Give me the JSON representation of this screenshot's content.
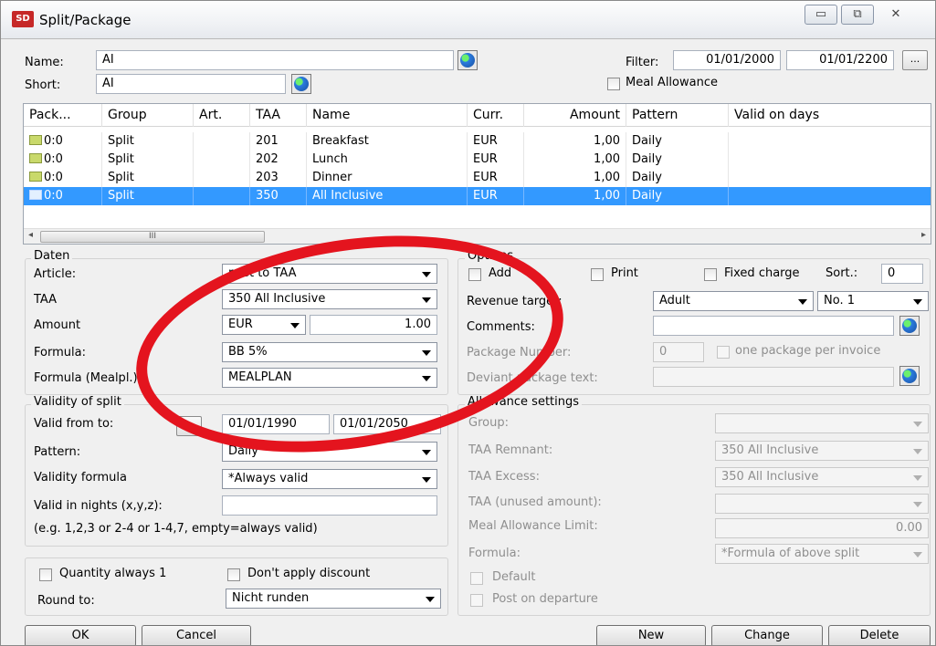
{
  "window": {
    "title": "Split/Package",
    "app_icon": "SD",
    "minimize_icon": "▭",
    "restore_icon": "⧉",
    "close_icon": "✕"
  },
  "header": {
    "name_label": "Name:",
    "name_value": "AI",
    "short_label": "Short:",
    "short_value": "AI",
    "filter_label": "Filter:",
    "filter_from": "01/01/2000",
    "filter_to": "01/01/2200",
    "filter_button": "...",
    "meal_allowance_label": "Meal Allowance"
  },
  "grid": {
    "columns": [
      "Pack...",
      "Group",
      "Art.",
      "TAA",
      "Name",
      "Curr.",
      "Amount",
      "Pattern",
      "Valid on days"
    ],
    "rows": [
      {
        "pack": "0:0",
        "group": "Split",
        "art": "",
        "taa": "201",
        "name": "Breakfast",
        "curr": "EUR",
        "amount": "1,00",
        "pattern": "Daily",
        "valid": ""
      },
      {
        "pack": "0:0",
        "group": "Split",
        "art": "",
        "taa": "202",
        "name": "Lunch",
        "curr": "EUR",
        "amount": "1,00",
        "pattern": "Daily",
        "valid": ""
      },
      {
        "pack": "0:0",
        "group": "Split",
        "art": "",
        "taa": "203",
        "name": "Dinner",
        "curr": "EUR",
        "amount": "1,00",
        "pattern": "Daily",
        "valid": ""
      },
      {
        "pack": "0:0",
        "group": "Split",
        "art": "",
        "taa": "350",
        "name": "All Inclusive",
        "curr": "EUR",
        "amount": "1,00",
        "pattern": "Daily",
        "valid": ""
      }
    ],
    "selected_row": 3,
    "scroll_left": "◂",
    "scroll_right": "▸",
    "scroll_thumb": "III"
  },
  "daten": {
    "title": "Daten",
    "article_label": "Article:",
    "article_value": "post to TAA",
    "taa_label": "TAA",
    "taa_value": "350 All Inclusive",
    "amount_label": "Amount",
    "currency_value": "EUR",
    "amount_value": "1.00",
    "formula_label": "Formula:",
    "formula_value": "BB 5%",
    "formula_mealpl_label": "Formula (Mealpl.):",
    "formula_mealpl_value": "MEALPLAN"
  },
  "validity": {
    "title": "Validity of split",
    "valid_from_label": "Valid from to:",
    "range_button": "...",
    "valid_from": "01/01/1990",
    "valid_to": "01/01/2050",
    "pattern_label": "Pattern:",
    "pattern_value": "Daily",
    "validity_formula_label": "Validity formula",
    "validity_formula_value": "*Always valid",
    "valid_nights_label": "Valid in nights (x,y,z):",
    "valid_nights_value": "",
    "hint": "(e.g. 1,2,3 or 2-4 or 1-4,7, empty=always valid)"
  },
  "misc": {
    "quantity_label": "Quantity always 1",
    "no_discount_label": "Don't apply discount",
    "round_label": "Round to:",
    "round_value": "Nicht runden"
  },
  "options": {
    "title": "Options",
    "add_label": "Add",
    "print_label": "Print",
    "fixed_charge_label": "Fixed charge",
    "sort_label": "Sort.:",
    "sort_value": "0",
    "revenue_target_label": "Revenue target:",
    "revenue_target_value": "Adult",
    "revenue_no_value": "No. 1",
    "comments_label": "Comments:",
    "comments_value": "",
    "package_number_label": "Package Number:",
    "package_number_value": "0",
    "one_package_label": "one package per invoice",
    "deviant_text_label": "Deviant package text:",
    "deviant_text_value": ""
  },
  "allowance": {
    "title": "Allowance settings",
    "group_label": "Group:",
    "group_value": "",
    "taa_remnant_label": "TAA Remnant:",
    "taa_remnant_value": "350 All Inclusive",
    "taa_excess_label": "TAA Excess:",
    "taa_excess_value": "350 All Inclusive",
    "taa_unused_label": "TAA (unused amount):",
    "taa_unused_value": "",
    "meal_limit_label": "Meal Allowance Limit:",
    "meal_limit_value": "0.00",
    "formula_label": "Formula:",
    "formula_value": "*Formula of above split",
    "default_label": "Default",
    "post_departure_label": "Post on departure"
  },
  "footer": {
    "ok": "OK",
    "cancel": "Cancel",
    "new": "New",
    "change": "Change",
    "delete": "Delete"
  },
  "colors": {
    "selection": "#3399ff",
    "annotation_red": "#e4141e"
  }
}
